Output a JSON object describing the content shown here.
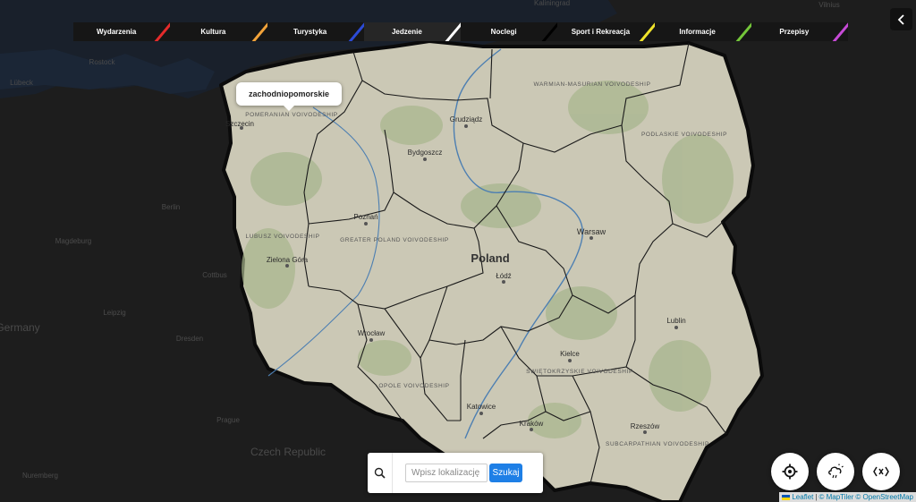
{
  "categories": [
    {
      "label": "Wydarzenia",
      "color": "#e52b2b"
    },
    {
      "label": "Kultura",
      "color": "#f2a33a"
    },
    {
      "label": "Turystyka",
      "color": "#2c4bd6"
    },
    {
      "label": "Jedzenie",
      "color": "#ffffff"
    },
    {
      "label": "Noclegi",
      "color": "#000000"
    },
    {
      "label": "Sport i Rekreacja",
      "color": "#f0e32a"
    },
    {
      "label": "Informacje",
      "color": "#74c63a"
    },
    {
      "label": "Przepisy",
      "color": "#c64ad6"
    }
  ],
  "active_category": "Jedzenie",
  "tooltip": {
    "label": "zachodniopomorskie"
  },
  "search": {
    "placeholder": "Wpisz lokalizację",
    "button_label": "Szukaj"
  },
  "controls": {
    "locate_icon": "crosshair-icon",
    "weather_icon": "weather-cloud-icon",
    "fullscreen_icon": "expand-icon",
    "collapse_icon": "chevron-left-icon"
  },
  "map": {
    "country_label": "Poland",
    "cities": [
      "Grudziądz",
      "Bydgoszcz",
      "Poznań",
      "Warsaw",
      "Łódź",
      "Lublin",
      "Wrocław",
      "Kielce",
      "Katowice",
      "Kraków",
      "Rzeszów",
      "Zielona Góra",
      "Szczecin"
    ],
    "regions": [
      "POMERANIAN VOIVODESHIP",
      "WARMIAN-MASURIAN VOIVODESHIP",
      "PODLASKIE VOIVODESHIP",
      "LUBUSZ VOIVODESHIP",
      "GREATER POLAND VOIVODESHIP",
      "OPOLE VOIVODESHIP",
      "ŚWIĘTOKRZYSKIE VOIVODESHIP",
      "SUBCARPATHIAN VOIVODESHIP"
    ],
    "outside_labels": [
      "Berlin",
      "Magdeburg",
      "Leipzig",
      "Dresden",
      "Prague",
      "Czech Republic",
      "Germany",
      "Vilnius",
      "Kaliningrad",
      "Lübeck",
      "Rostock",
      "Nuremberg",
      "Cottbus"
    ]
  },
  "attribution": {
    "leaflet": "Leaflet",
    "sep1": "|",
    "maptiler": "© MapTiler",
    "osm": "© OpenStreetMap"
  }
}
